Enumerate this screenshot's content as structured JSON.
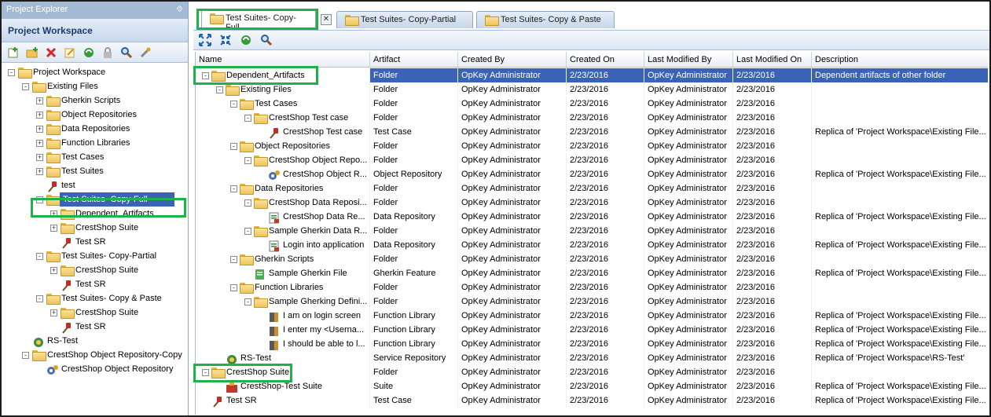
{
  "left_panel": {
    "title": "Project Explorer",
    "pin": "⯑",
    "workspace_header": "Project Workspace",
    "toolbar": [
      "add-item-icon",
      "add-folder-icon",
      "delete-icon",
      "rename-icon",
      "refresh-icon",
      "lock-icon",
      "search-icon",
      "tools-icon"
    ],
    "tree": [
      {
        "label": "Project Workspace",
        "level": 0,
        "exp": "-",
        "icon": "folder"
      },
      {
        "label": "Existing Files",
        "level": 1,
        "exp": "-",
        "icon": "folder"
      },
      {
        "label": "Gherkin Scripts",
        "level": 2,
        "exp": "+",
        "icon": "folder"
      },
      {
        "label": "Object Repositories",
        "level": 2,
        "exp": "+",
        "icon": "folder"
      },
      {
        "label": "Data Repositories",
        "level": 2,
        "exp": "+",
        "icon": "folder"
      },
      {
        "label": "Function Libraries",
        "level": 2,
        "exp": "+",
        "icon": "folder"
      },
      {
        "label": "Test Cases",
        "level": 2,
        "exp": "+",
        "icon": "folder"
      },
      {
        "label": "Test Suites",
        "level": 2,
        "exp": "+",
        "icon": "folder"
      },
      {
        "label": "test",
        "level": 2,
        "exp": "",
        "icon": "testcase"
      },
      {
        "label": "Test Suites- Copy-Full",
        "level": 2,
        "exp": "-",
        "icon": "folder",
        "selected": true
      },
      {
        "label": "Dependent_Artifacts",
        "level": 3,
        "exp": "+",
        "icon": "folder"
      },
      {
        "label": "CrestShop Suite",
        "level": 3,
        "exp": "+",
        "icon": "folder"
      },
      {
        "label": "Test SR",
        "level": 3,
        "exp": "",
        "icon": "testcase"
      },
      {
        "label": "Test Suites- Copy-Partial",
        "level": 2,
        "exp": "-",
        "icon": "folder"
      },
      {
        "label": "CrestShop Suite",
        "level": 3,
        "exp": "+",
        "icon": "folder"
      },
      {
        "label": "Test SR",
        "level": 3,
        "exp": "",
        "icon": "testcase"
      },
      {
        "label": "Test Suites- Copy & Paste",
        "level": 2,
        "exp": "-",
        "icon": "folder"
      },
      {
        "label": "CrestShop Suite",
        "level": 3,
        "exp": "+",
        "icon": "folder"
      },
      {
        "label": "Test SR",
        "level": 3,
        "exp": "",
        "icon": "testcase"
      },
      {
        "label": "RS-Test",
        "level": 1,
        "exp": "",
        "icon": "service"
      },
      {
        "label": "CrestShop Object Repository-Copy",
        "level": 1,
        "exp": "-",
        "icon": "folder"
      },
      {
        "label": "CrestShop Object Repository",
        "level": 2,
        "exp": "",
        "icon": "objrepo"
      }
    ]
  },
  "tabs": [
    {
      "label": "Test Suites- Copy-Full",
      "active": true
    },
    {
      "label": "Test Suites- Copy-Partial",
      "active": false
    },
    {
      "label": "Test Suites- Copy & Paste",
      "active": false
    }
  ],
  "tab_close": "✕",
  "right_toolbar": [
    "expand-all-icon",
    "collapse-all-icon",
    "refresh-icon",
    "search-icon"
  ],
  "columns": [
    "Name",
    "Artifact",
    "Created By",
    "Created On",
    "Last Modified By",
    "Last Modified On",
    "Description"
  ],
  "rows": [
    {
      "name": "Dependent_Artifacts",
      "level": 0,
      "exp": "-",
      "icon": "folder",
      "artifact": "Folder",
      "created_by": "OpKey Administrator",
      "created_on": "2/23/2016",
      "modified_by": "OpKey Administrator",
      "modified_on": "2/23/2016",
      "description": "Dependent artifacts of other folder",
      "selected": true
    },
    {
      "name": "Existing Files",
      "level": 1,
      "exp": "-",
      "icon": "folder",
      "artifact": "Folder",
      "created_by": "OpKey Administrator",
      "created_on": "2/23/2016",
      "modified_by": "OpKey Administrator",
      "modified_on": "2/23/2016",
      "description": ""
    },
    {
      "name": "Test Cases",
      "level": 2,
      "exp": "-",
      "icon": "folder",
      "artifact": "Folder",
      "created_by": "OpKey Administrator",
      "created_on": "2/23/2016",
      "modified_by": "OpKey Administrator",
      "modified_on": "2/23/2016",
      "description": ""
    },
    {
      "name": "CrestShop Test case",
      "level": 3,
      "exp": "-",
      "icon": "folder",
      "artifact": "Folder",
      "created_by": "OpKey Administrator",
      "created_on": "2/23/2016",
      "modified_by": "OpKey Administrator",
      "modified_on": "2/23/2016",
      "description": ""
    },
    {
      "name": "CrestShop Test case",
      "level": 4,
      "exp": "",
      "icon": "testcase",
      "artifact": "Test Case",
      "created_by": "OpKey Administrator",
      "created_on": "2/23/2016",
      "modified_by": "OpKey Administrator",
      "modified_on": "2/23/2016",
      "description": "Replica of 'Project Workspace\\Existing File..."
    },
    {
      "name": "Object Repositories",
      "level": 2,
      "exp": "-",
      "icon": "folder",
      "artifact": "Folder",
      "created_by": "OpKey Administrator",
      "created_on": "2/23/2016",
      "modified_by": "OpKey Administrator",
      "modified_on": "2/23/2016",
      "description": ""
    },
    {
      "name": "CrestShop Object Repo...",
      "level": 3,
      "exp": "-",
      "icon": "folder",
      "artifact": "Folder",
      "created_by": "OpKey Administrator",
      "created_on": "2/23/2016",
      "modified_by": "OpKey Administrator",
      "modified_on": "2/23/2016",
      "description": ""
    },
    {
      "name": "CrestShop Object R...",
      "level": 4,
      "exp": "",
      "icon": "objrepo",
      "artifact": "Object Repository",
      "created_by": "OpKey Administrator",
      "created_on": "2/23/2016",
      "modified_by": "OpKey Administrator",
      "modified_on": "2/23/2016",
      "description": "Replica of 'Project Workspace\\Existing File..."
    },
    {
      "name": "Data Repositories",
      "level": 2,
      "exp": "-",
      "icon": "folder",
      "artifact": "Folder",
      "created_by": "OpKey Administrator",
      "created_on": "2/23/2016",
      "modified_by": "OpKey Administrator",
      "modified_on": "2/23/2016",
      "description": ""
    },
    {
      "name": "CrestShop Data Reposi...",
      "level": 3,
      "exp": "-",
      "icon": "folder",
      "artifact": "Folder",
      "created_by": "OpKey Administrator",
      "created_on": "2/23/2016",
      "modified_by": "OpKey Administrator",
      "modified_on": "2/23/2016",
      "description": ""
    },
    {
      "name": "CrestShop Data Re...",
      "level": 4,
      "exp": "",
      "icon": "datarepo",
      "artifact": "Data Repository",
      "created_by": "OpKey Administrator",
      "created_on": "2/23/2016",
      "modified_by": "OpKey Administrator",
      "modified_on": "2/23/2016",
      "description": "Replica of 'Project Workspace\\Existing File..."
    },
    {
      "name": "Sample Gherkin Data R...",
      "level": 3,
      "exp": "-",
      "icon": "folder",
      "artifact": "Folder",
      "created_by": "OpKey Administrator",
      "created_on": "2/23/2016",
      "modified_by": "OpKey Administrator",
      "modified_on": "2/23/2016",
      "description": ""
    },
    {
      "name": "Login into application",
      "level": 4,
      "exp": "",
      "icon": "datarepo",
      "artifact": "Data Repository",
      "created_by": "OpKey Administrator",
      "created_on": "2/23/2016",
      "modified_by": "OpKey Administrator",
      "modified_on": "2/23/2016",
      "description": "Replica of 'Project Workspace\\Existing File..."
    },
    {
      "name": "Gherkin Scripts",
      "level": 2,
      "exp": "-",
      "icon": "folder",
      "artifact": "Folder",
      "created_by": "OpKey Administrator",
      "created_on": "2/23/2016",
      "modified_by": "OpKey Administrator",
      "modified_on": "2/23/2016",
      "description": ""
    },
    {
      "name": "Sample Gherkin File",
      "level": 3,
      "exp": "",
      "icon": "gherkin",
      "artifact": "Gherkin Feature",
      "created_by": "OpKey Administrator",
      "created_on": "2/23/2016",
      "modified_by": "OpKey Administrator",
      "modified_on": "2/23/2016",
      "description": "Replica of 'Project Workspace\\Existing File..."
    },
    {
      "name": "Function Libraries",
      "level": 2,
      "exp": "-",
      "icon": "folder",
      "artifact": "Folder",
      "created_by": "OpKey Administrator",
      "created_on": "2/23/2016",
      "modified_by": "OpKey Administrator",
      "modified_on": "2/23/2016",
      "description": ""
    },
    {
      "name": "Sample Gherking Defini...",
      "level": 3,
      "exp": "-",
      "icon": "folder",
      "artifact": "Folder",
      "created_by": "OpKey Administrator",
      "created_on": "2/23/2016",
      "modified_by": "OpKey Administrator",
      "modified_on": "2/23/2016",
      "description": ""
    },
    {
      "name": "I am on login screen",
      "level": 4,
      "exp": "",
      "icon": "function",
      "artifact": "Function Library",
      "created_by": "OpKey Administrator",
      "created_on": "2/23/2016",
      "modified_by": "OpKey Administrator",
      "modified_on": "2/23/2016",
      "description": "Replica of 'Project Workspace\\Existing File..."
    },
    {
      "name": "I enter my <Userna...",
      "level": 4,
      "exp": "",
      "icon": "function",
      "artifact": "Function Library",
      "created_by": "OpKey Administrator",
      "created_on": "2/23/2016",
      "modified_by": "OpKey Administrator",
      "modified_on": "2/23/2016",
      "description": "Replica of 'Project Workspace\\Existing File..."
    },
    {
      "name": "I should be able to l...",
      "level": 4,
      "exp": "",
      "icon": "function",
      "artifact": "Function Library",
      "created_by": "OpKey Administrator",
      "created_on": "2/23/2016",
      "modified_by": "OpKey Administrator",
      "modified_on": "2/23/2016",
      "description": "Replica of 'Project Workspace\\Existing File..."
    },
    {
      "name": "RS-Test",
      "level": 1,
      "exp": "",
      "icon": "service",
      "artifact": "Service Repository",
      "created_by": "OpKey Administrator",
      "created_on": "2/23/2016",
      "modified_by": "OpKey Administrator",
      "modified_on": "2/23/2016",
      "description": "Replica of 'Project Workspace\\RS-Test'"
    },
    {
      "name": "CrestShop Suite",
      "level": 0,
      "exp": "-",
      "icon": "folder",
      "artifact": "Folder",
      "created_by": "OpKey Administrator",
      "created_on": "2/23/2016",
      "modified_by": "OpKey Administrator",
      "modified_on": "2/23/2016",
      "description": ""
    },
    {
      "name": "CrestShop-Test Suite",
      "level": 1,
      "exp": "",
      "icon": "suite",
      "artifact": "Suite",
      "created_by": "OpKey Administrator",
      "created_on": "2/23/2016",
      "modified_by": "OpKey Administrator",
      "modified_on": "2/23/2016",
      "description": "Replica of 'Project Workspace\\Existing File..."
    },
    {
      "name": "Test SR",
      "level": 0,
      "exp": "",
      "icon": "testcase",
      "artifact": "Test Case",
      "created_by": "OpKey Administrator",
      "created_on": "2/23/2016",
      "modified_by": "OpKey Administrator",
      "modified_on": "2/23/2016",
      "description": "Replica of 'Project Workspace\\Existing File..."
    }
  ]
}
